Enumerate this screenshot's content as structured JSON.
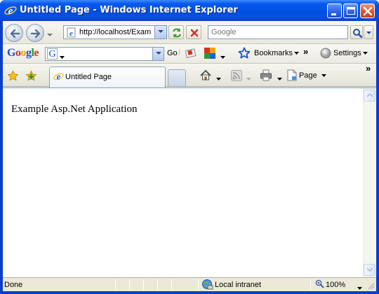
{
  "window": {
    "title": "Untitled Page - Windows Internet Explorer"
  },
  "address_bar": {
    "url": "http://localhost/Exam"
  },
  "search": {
    "placeholder": "Google"
  },
  "google_toolbar": {
    "logo_text": "Google",
    "go_label": "Go",
    "bookmarks_label": "Bookmarks",
    "settings_label": "Settings"
  },
  "tabs": [
    {
      "label": "Untitled Page"
    }
  ],
  "command_bar": {
    "page_label": "Page"
  },
  "content": {
    "text": "Example Asp.Net Application"
  },
  "status_bar": {
    "status_text": "Done",
    "zone_text": "Local intranet",
    "zoom_text": "100%"
  },
  "colors": {
    "titlebar": "#0050e4",
    "frame": "#f0efe7",
    "statusbar": "#ece9d8"
  },
  "icons": [
    "ie-icon",
    "back-icon",
    "forward-icon",
    "refresh-icon",
    "stop-icon",
    "search-icon",
    "favorites-star-icon",
    "add-favorites-icon",
    "home-icon",
    "feeds-icon",
    "print-icon",
    "page-icon",
    "local-intranet-icon",
    "zoom-icon",
    "settings-icon",
    "bookmarks-star-icon"
  ]
}
